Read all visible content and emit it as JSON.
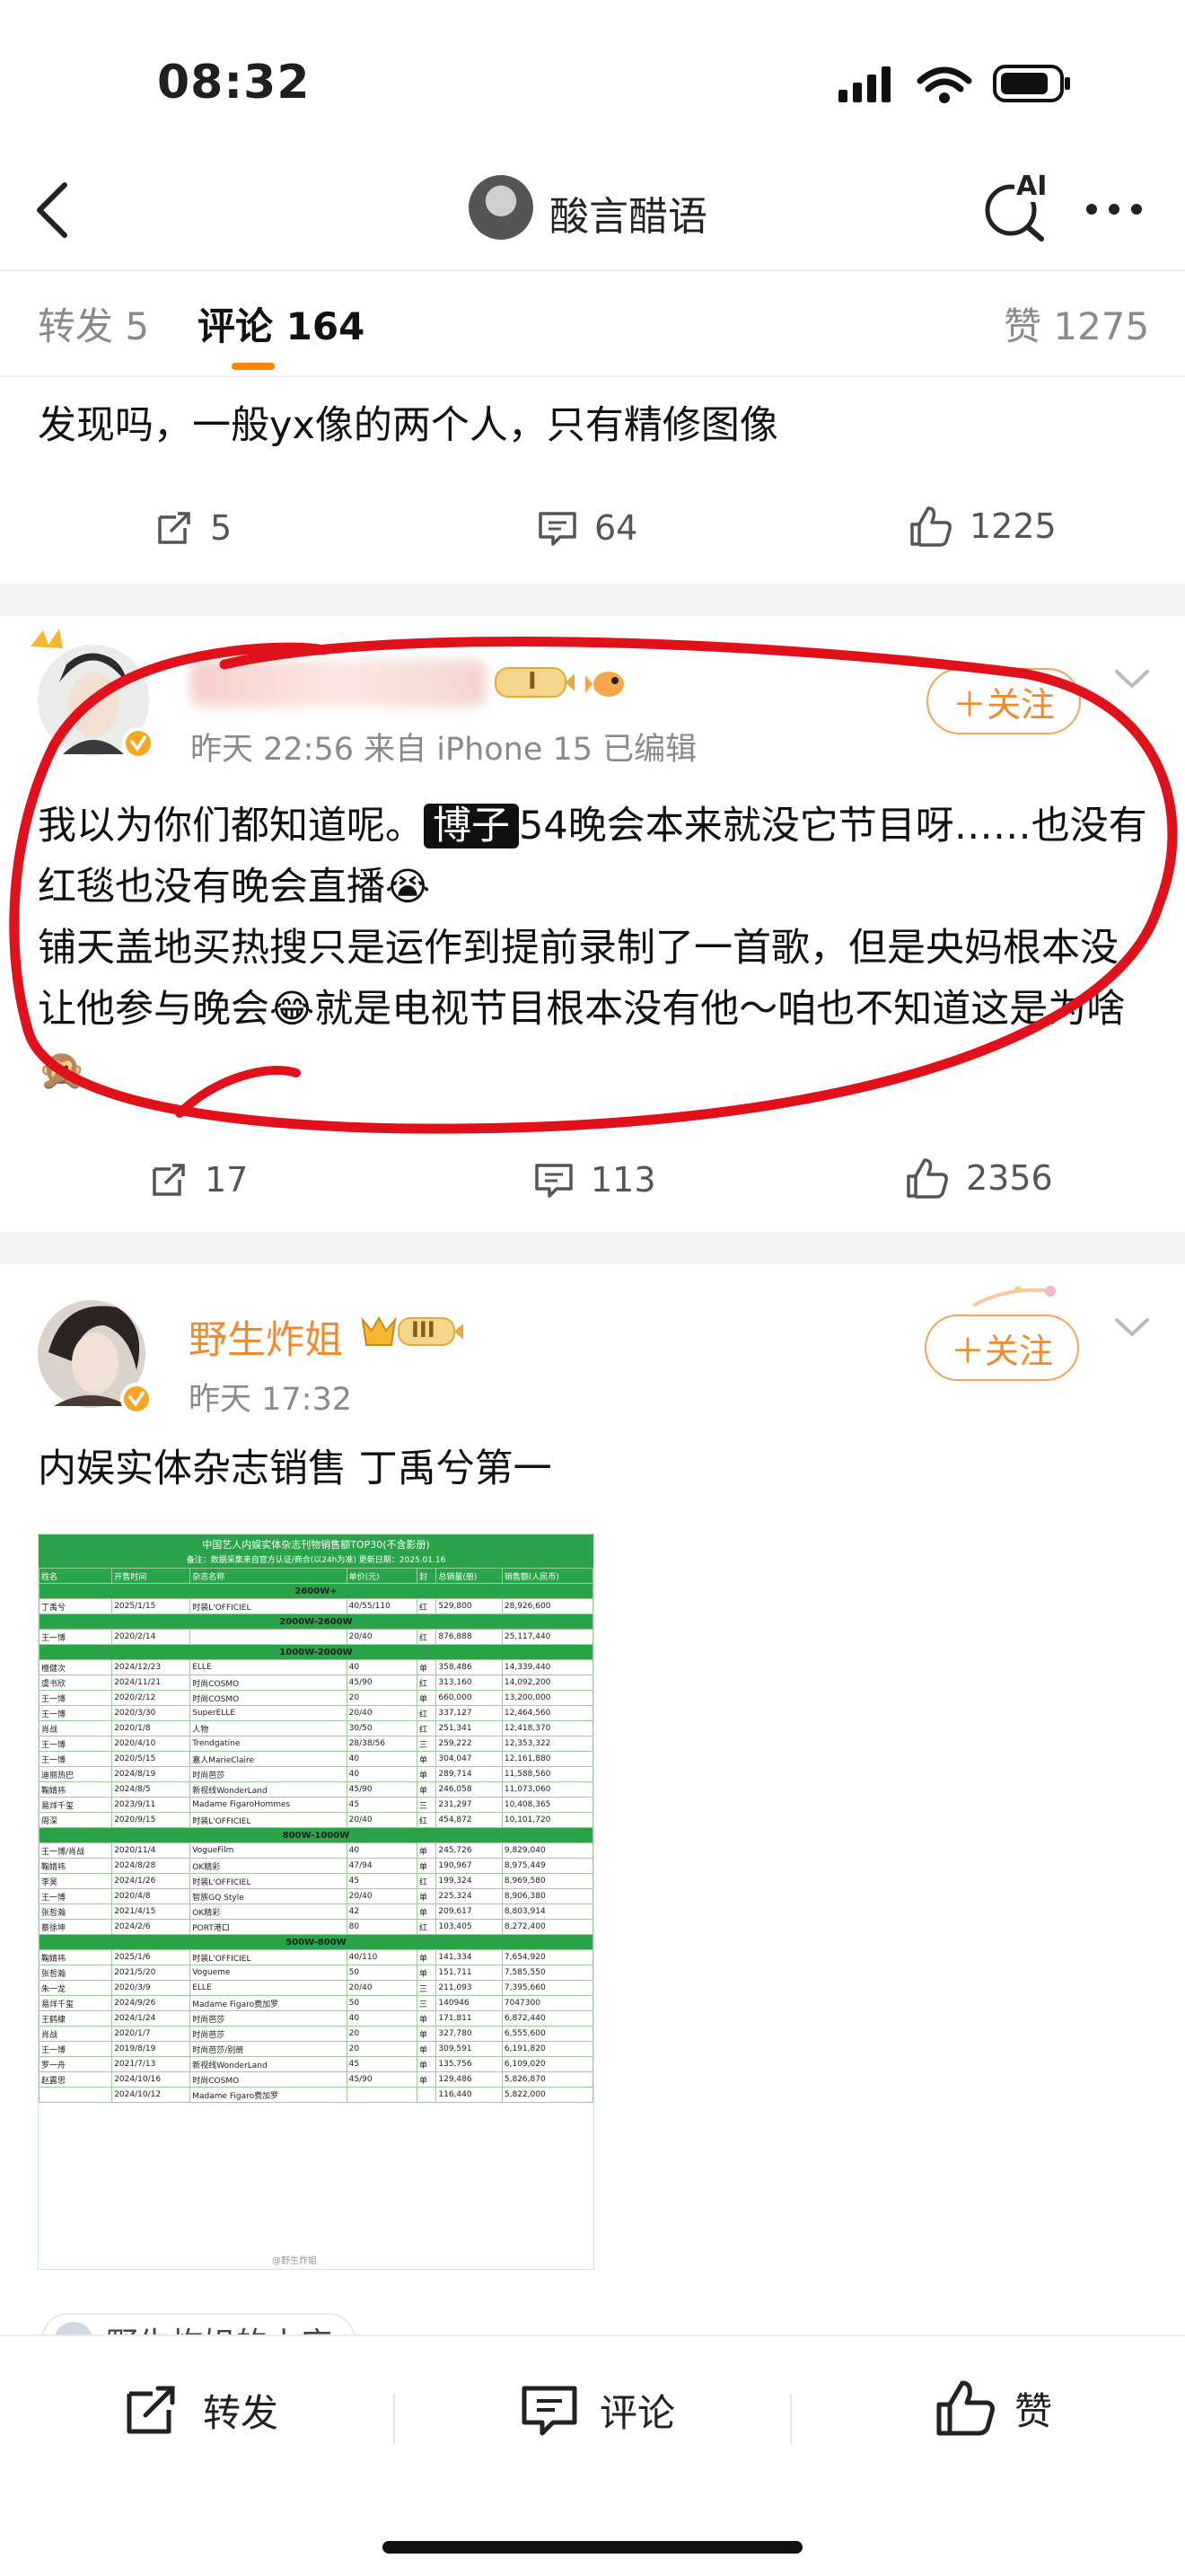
{
  "status_bar": {
    "time": "08:32"
  },
  "header": {
    "title": "酸言醋语",
    "ai_label": "AI"
  },
  "tabs": {
    "repost": "转发 5",
    "comment": "评论 164",
    "like": "赞 1275"
  },
  "prev_comment": {
    "text": "发现吗，一般yx像的两个人，只有精修图像",
    "repost_count": "5",
    "comment_count": "64",
    "like_count": "1225"
  },
  "comment1": {
    "meta": "昨天 22:56  来自 iPhone 15  已编辑",
    "follow_label": "＋关注",
    "text_pre": "我以为你们都知道呢。",
    "highlight": "博子",
    "text_post": "54晚会本来就没它节目呀……也没有红毯也没有晚会直播😭\n铺天盖地买热搜只是运作到提前录制了一首歌，但是央妈根本没让他参与晚会😂就是电视节目根本没有他～咱也不知道这是为啥🙊",
    "level_badge": "I",
    "repost_count": "17",
    "comment_count": "113",
    "like_count": "2356"
  },
  "comment2": {
    "username": "野生炸姐",
    "level_badge": "III",
    "time": "昨天 17:32",
    "follow_label": "＋关注",
    "text": "内娱实体杂志销售 丁禹兮第一",
    "image": {
      "title": "中国艺人内娱实体杂志刊物销售额TOP30(不含影册)",
      "subtitle": "备注：数据采集来自官方认证/商合(以24h为准) 更新日期：2025.01.16",
      "columns": [
        "姓名",
        "开售时间",
        "杂志名称",
        "单价(元)",
        "封",
        "总销量(册)",
        "销售额(人民币)"
      ],
      "sections": [
        {
          "band": "2600W+",
          "rows": [
            [
              "丁禹兮",
              "2025/1/15",
              "时装L'OFFICIEL",
              "40/55/110",
              "红",
              "529,800",
              "28,926,600"
            ]
          ]
        },
        {
          "band": "2000W-2600W",
          "rows": [
            [
              "王一博",
              "2020/2/14",
              "",
              "20/40",
              "红",
              "876,888",
              "25,117,440"
            ]
          ]
        },
        {
          "band": "1000W-2000W",
          "rows": [
            [
              "檀健次",
              "2024/12/23",
              "ELLE",
              "40",
              "单",
              "358,486",
              "14,339,440"
            ],
            [
              "虞书欣",
              "2024/11/21",
              "时尚COSMO",
              "45/90",
              "红",
              "313,160",
              "14,092,200"
            ],
            [
              "王一博",
              "2020/2/12",
              "时尚COSMO",
              "20",
              "单",
              "660,000",
              "13,200,000"
            ],
            [
              "王一博",
              "2020/3/30",
              "SuperELLE",
              "20/40",
              "红",
              "337,127",
              "12,464,560"
            ],
            [
              "肖战",
              "2020/1/8",
              "人物",
              "30/50",
              "红",
              "251,341",
              "12,418,370"
            ],
            [
              "王一博",
              "2020/4/10",
              "Trendgatine",
              "28/38/56",
              "三",
              "259,222",
              "12,353,322"
            ],
            [
              "王一博",
              "2020/5/15",
              "嘉人MarieClaire",
              "40",
              "单",
              "304,047",
              "12,161,880"
            ],
            [
              "迪丽热巴",
              "2024/8/19",
              "时尚芭莎",
              "40",
              "单",
              "289,714",
              "11,588,560"
            ],
            [
              "鞠婧祎",
              "2024/8/5",
              "新视线WonderLand",
              "45/90",
              "单",
              "246,058",
              "11,073,060"
            ],
            [
              "易烊千玺",
              "2023/9/11",
              "Madame FigaroHommes",
              "45",
              "三",
              "231,297",
              "10,408,365"
            ],
            [
              "周深",
              "2020/9/15",
              "时装L'OFFICIEL",
              "20/40",
              "红",
              "454,872",
              "10,101,720"
            ]
          ]
        },
        {
          "band": "800W-1000W",
          "rows": [
            [
              "王一博/肖战",
              "2020/11/4",
              "VogueFilm",
              "40",
              "单",
              "245,726",
              "9,829,040"
            ],
            [
              "鞠婧祎",
              "2024/8/28",
              "OK精彩",
              "47/94",
              "单",
              "190,967",
              "8,975,449"
            ],
            [
              "李昊",
              "2024/1/26",
              "时装L'OFFICIEL",
              "45",
              "红",
              "199,324",
              "8,969,580"
            ],
            [
              "王一博",
              "2020/4/8",
              "智族GQ Style",
              "20/40",
              "单",
              "225,324",
              "8,906,380"
            ],
            [
              "张哲瀚",
              "2021/4/15",
              "OK精彩",
              "42",
              "单",
              "209,617",
              "8,803,914"
            ],
            [
              "蔡徐坤",
              "2024/2/6",
              "PORT港口",
              "80",
              "红",
              "103,405",
              "8,272,400"
            ]
          ]
        },
        {
          "band": "500W-800W",
          "rows": [
            [
              "鞠婧祎",
              "2025/1/6",
              "时装L'OFFICIEL",
              "40/110",
              "单",
              "141,334",
              "7,654,920"
            ],
            [
              "张哲瀚",
              "2021/5/20",
              "Vogueme",
              "50",
              "单",
              "151,711",
              "7,585,550"
            ],
            [
              "朱一龙",
              "2020/3/9",
              "ELLE",
              "20/40",
              "三",
              "211,093",
              "7,395,660"
            ],
            [
              "易烊千玺",
              "2024/9/26",
              "Madame Figaro费加罗",
              "50",
              "三",
              "140946",
              "7047300"
            ],
            [
              "王鹤棣",
              "2024/1/24",
              "时尚芭莎",
              "40",
              "单",
              "171,811",
              "6,872,440"
            ],
            [
              "肖战",
              "2020/1/7",
              "时尚芭莎",
              "20",
              "单",
              "327,780",
              "6,555,600"
            ],
            [
              "王一博",
              "2019/8/19",
              "时尚芭莎/别册",
              "20",
              "单",
              "309,591",
              "6,191,820"
            ],
            [
              "罗一舟",
              "2021/7/13",
              "新视线WonderLand",
              "45",
              "单",
              "135,756",
              "6,109,020"
            ],
            [
              "赵露思",
              "2024/10/16",
              "时尚COSMO",
              "45/90",
              "单",
              "129,486",
              "5,826,870"
            ],
            [
              "",
              "2024/10/12",
              "Madame Figaro费加罗",
              "",
              "",
              "116,440",
              "5,822,000"
            ]
          ]
        }
      ],
      "watermark": "@野生炸姐"
    },
    "source_chip": "野生炸姐的小店"
  },
  "bottom_bar": {
    "repost_label": "转发",
    "comment_label": "评论",
    "like_label": "赞"
  },
  "colors": {
    "accent": "#ff8200",
    "circle_annotation": "#e0111b",
    "follow": "#f08a2d",
    "table_green": "#2aa44a"
  }
}
